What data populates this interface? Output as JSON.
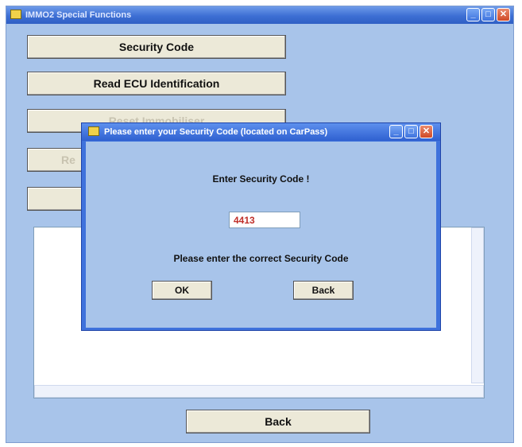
{
  "main": {
    "title": "IMMO2 Special Functions",
    "buttons": [
      {
        "label": "Security Code",
        "enabled": true
      },
      {
        "label": "Read ECU Identification",
        "enabled": true
      },
      {
        "label": "Reset Immobiliser",
        "enabled": false
      },
      {
        "label": "Re",
        "enabled": false
      },
      {
        "label": "",
        "enabled": false
      }
    ],
    "back_label": "Back"
  },
  "dialog": {
    "title": "Please enter your Security Code (located on CarPass)",
    "heading": "Enter Security Code !",
    "code_value": "4413",
    "message": "Please enter the correct Security Code",
    "ok_label": "OK",
    "back_label": "Back"
  },
  "icons": {
    "minimize": "_",
    "maximize": "□",
    "close": "✕"
  }
}
